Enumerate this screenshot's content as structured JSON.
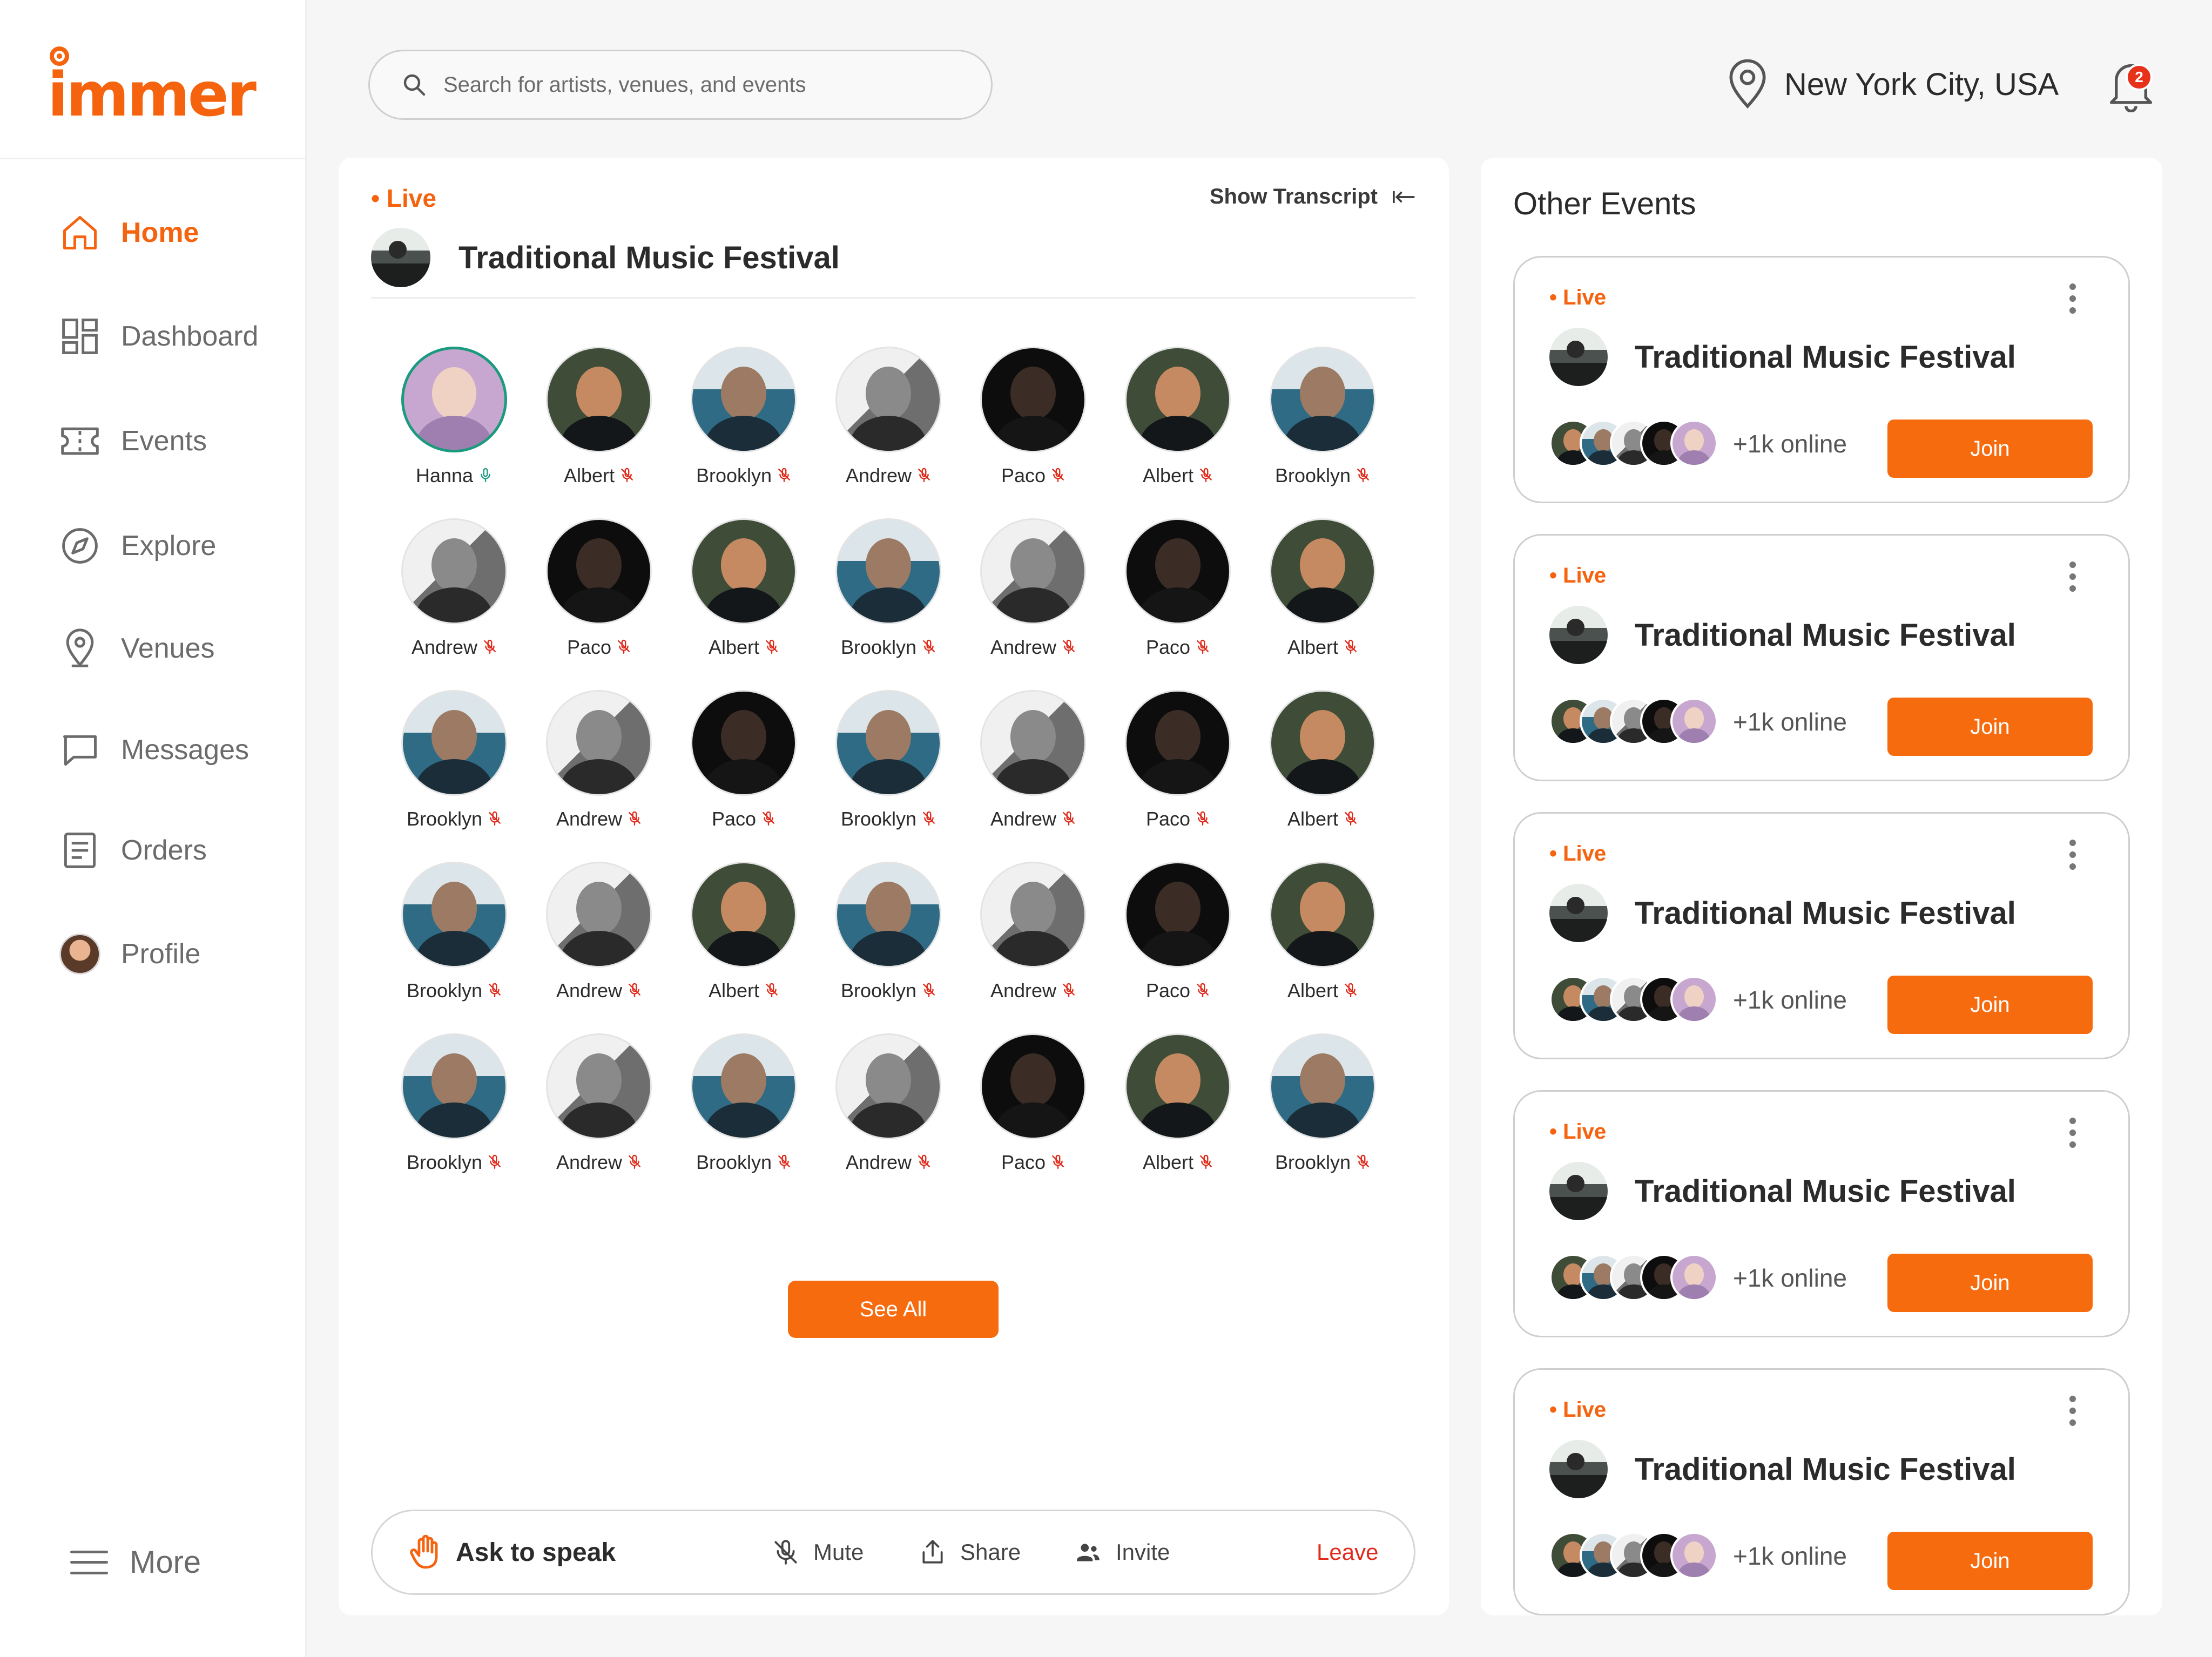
{
  "app": {
    "logo": "immer"
  },
  "sidebar": {
    "items": [
      {
        "label": "Home",
        "icon": "home-icon",
        "active": true
      },
      {
        "label": "Dashboard",
        "icon": "dashboard-icon"
      },
      {
        "label": "Events",
        "icon": "ticket-icon"
      },
      {
        "label": "Explore",
        "icon": "compass-icon"
      },
      {
        "label": "Venues",
        "icon": "location-pin-icon"
      },
      {
        "label": "Messages",
        "icon": "message-icon"
      },
      {
        "label": "Orders",
        "icon": "orders-icon"
      },
      {
        "label": "Profile",
        "icon": "profile-avatar"
      }
    ],
    "more_label": "More"
  },
  "header": {
    "search_placeholder": "Search for artists, venues, and events",
    "location": "New York City, USA",
    "notification_count": "2"
  },
  "main": {
    "live_label": "Live",
    "show_transcript": "Show Transcript",
    "title": "Traditional Music Festival",
    "participants": [
      {
        "name": "Hanna",
        "avatar": "hanna",
        "mic": "on"
      },
      {
        "name": "Albert",
        "avatar": "albert",
        "mic": "off"
      },
      {
        "name": "Brooklyn",
        "avatar": "brooklyn",
        "mic": "off"
      },
      {
        "name": "Andrew",
        "avatar": "andrew",
        "mic": "off"
      },
      {
        "name": "Paco",
        "avatar": "paco",
        "mic": "off"
      },
      {
        "name": "Albert",
        "avatar": "albert",
        "mic": "off"
      },
      {
        "name": "Brooklyn",
        "avatar": "brooklyn",
        "mic": "off"
      },
      {
        "name": "Andrew",
        "avatar": "andrew",
        "mic": "off"
      },
      {
        "name": "Paco",
        "avatar": "paco",
        "mic": "off"
      },
      {
        "name": "Albert",
        "avatar": "albert",
        "mic": "off"
      },
      {
        "name": "Brooklyn",
        "avatar": "brooklyn",
        "mic": "off"
      },
      {
        "name": "Andrew",
        "avatar": "andrew",
        "mic": "off"
      },
      {
        "name": "Paco",
        "avatar": "paco",
        "mic": "off"
      },
      {
        "name": "Albert",
        "avatar": "albert",
        "mic": "off"
      },
      {
        "name": "Brooklyn",
        "avatar": "brooklyn",
        "mic": "off"
      },
      {
        "name": "Andrew",
        "avatar": "andrew",
        "mic": "off"
      },
      {
        "name": "Paco",
        "avatar": "paco",
        "mic": "off"
      },
      {
        "name": "Brooklyn",
        "avatar": "brooklyn",
        "mic": "off"
      },
      {
        "name": "Andrew",
        "avatar": "andrew",
        "mic": "off"
      },
      {
        "name": "Paco",
        "avatar": "paco",
        "mic": "off"
      },
      {
        "name": "Albert",
        "avatar": "albert",
        "mic": "off"
      },
      {
        "name": "Brooklyn",
        "avatar": "brooklyn",
        "mic": "off"
      },
      {
        "name": "Andrew",
        "avatar": "andrew",
        "mic": "off"
      },
      {
        "name": "Albert",
        "avatar": "albert",
        "mic": "off"
      },
      {
        "name": "Brooklyn",
        "avatar": "brooklyn",
        "mic": "off"
      },
      {
        "name": "Andrew",
        "avatar": "andrew",
        "mic": "off"
      },
      {
        "name": "Paco",
        "avatar": "paco",
        "mic": "off"
      },
      {
        "name": "Albert",
        "avatar": "albert",
        "mic": "off"
      },
      {
        "name": "Brooklyn",
        "avatar": "brooklyn",
        "mic": "off"
      },
      {
        "name": "Andrew",
        "avatar": "andrew",
        "mic": "off"
      },
      {
        "name": "Brooklyn",
        "avatar": "brooklyn",
        "mic": "off"
      },
      {
        "name": "Andrew",
        "avatar": "andrew",
        "mic": "off"
      },
      {
        "name": "Paco",
        "avatar": "paco",
        "mic": "off"
      },
      {
        "name": "Albert",
        "avatar": "albert",
        "mic": "off"
      },
      {
        "name": "Brooklyn",
        "avatar": "brooklyn",
        "mic": "off"
      }
    ],
    "see_all": "See All",
    "actions": {
      "ask_to_speak": "Ask to speak",
      "mute": "Mute",
      "share": "Share",
      "invite": "Invite",
      "leave": "Leave"
    }
  },
  "other_events": {
    "title": "Other Events",
    "cards": [
      {
        "live_label": "Live",
        "title": "Traditional Music Festival",
        "online": "+1k online",
        "join": "Join"
      },
      {
        "live_label": "Live",
        "title": "Traditional Music Festival",
        "online": "+1k online",
        "join": "Join"
      },
      {
        "live_label": "Live",
        "title": "Traditional Music Festival",
        "online": "+1k online",
        "join": "Join"
      },
      {
        "live_label": "Live",
        "title": "Traditional Music Festival",
        "online": "+1k online",
        "join": "Join"
      },
      {
        "live_label": "Live",
        "title": "Traditional Music Festival",
        "online": "+1k online",
        "join": "Join"
      }
    ]
  },
  "colors": {
    "accent": "#f76b0f",
    "live": "#f5630e",
    "leave": "#e02a1a",
    "mic_on": "#1b9a7d",
    "mic_off": "#e02a1a"
  }
}
